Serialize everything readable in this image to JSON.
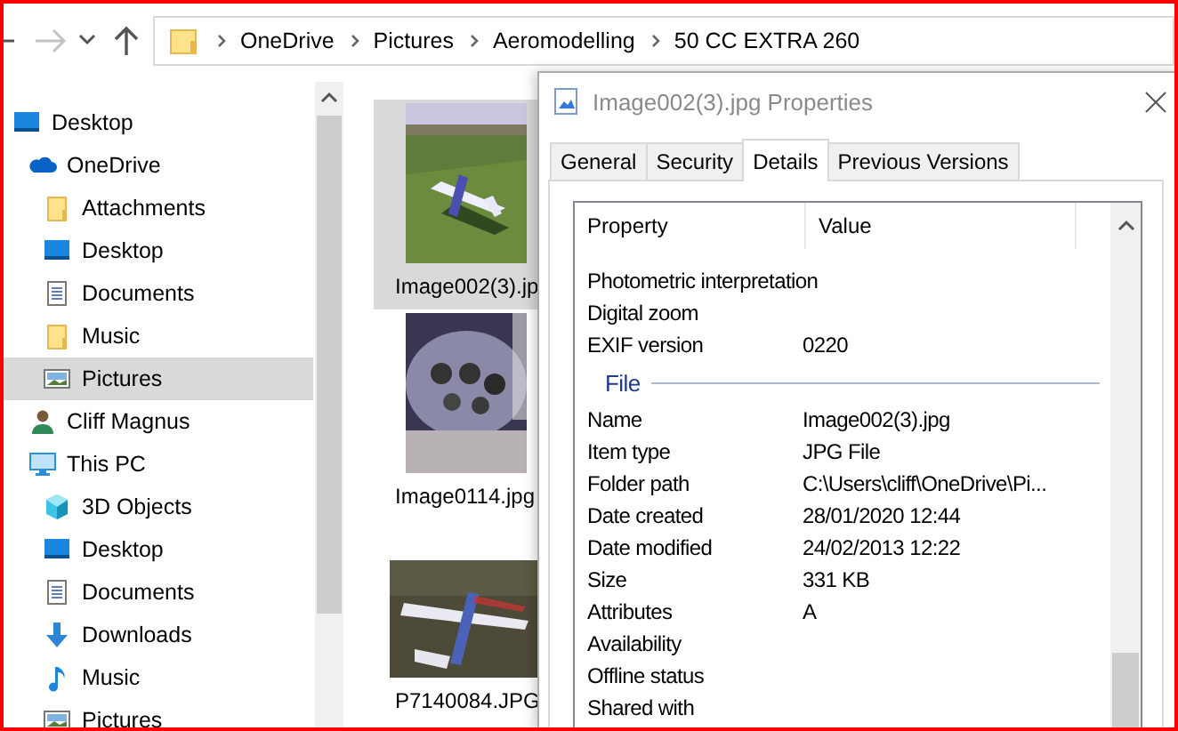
{
  "navigation": [
    {
      "kind": "back",
      "disabled": false
    },
    {
      "kind": "forward",
      "disabled": true
    },
    {
      "kind": "recent",
      "disabled": false
    },
    {
      "kind": "up",
      "disabled": false
    }
  ],
  "address_bar": {
    "path": [
      "OneDrive",
      "Pictures",
      "Aeromodelling",
      "50 CC EXTRA 260"
    ]
  },
  "tree": [
    {
      "label": "Desktop",
      "kind": "desktop",
      "selected": false,
      "children": [
        {
          "label": "OneDrive",
          "kind": "cloud",
          "selected": false,
          "children": [
            {
              "label": "Attachments",
              "kind": "folder",
              "selected": false
            },
            {
              "label": "Desktop",
              "kind": "desktop",
              "selected": false
            },
            {
              "label": "Documents",
              "kind": "document",
              "selected": false
            },
            {
              "label": "Music",
              "kind": "folder",
              "selected": false
            },
            {
              "label": "Pictures",
              "kind": "pictures",
              "selected": true
            }
          ]
        },
        {
          "label": "Cliff Magnus",
          "kind": "user",
          "selected": false
        },
        {
          "label": "This PC",
          "kind": "pc",
          "selected": false,
          "children": [
            {
              "label": "3D Objects",
              "kind": "cube",
              "selected": false
            },
            {
              "label": "Desktop",
              "kind": "desktop",
              "selected": false
            },
            {
              "label": "Documents",
              "kind": "document",
              "selected": false
            },
            {
              "label": "Downloads",
              "kind": "download",
              "selected": false
            },
            {
              "label": "Music",
              "kind": "music",
              "selected": false
            },
            {
              "label": "Pictures",
              "kind": "pictures",
              "selected": false
            }
          ]
        }
      ]
    }
  ],
  "thumbnails": [
    {
      "label": "Image002(3).jp",
      "selected": true
    },
    {
      "label": "Image0114.jpg",
      "selected": false
    },
    {
      "label": "P7140084.JPG",
      "selected": false
    }
  ],
  "dialog": {
    "title": "Image002(3).jpg Properties",
    "tabs": [
      {
        "label": "General",
        "selected": false
      },
      {
        "label": "Security",
        "selected": false
      },
      {
        "label": "Details",
        "selected": true
      },
      {
        "label": "Previous Versions",
        "selected": false
      }
    ],
    "columns": [
      "Property",
      "Value"
    ],
    "rows": [
      {
        "kind": "row",
        "property": "Photometric interpretation"
      },
      {
        "kind": "row",
        "property": "Digital zoom"
      },
      {
        "kind": "row",
        "property": "EXIF version",
        "value": "0220"
      },
      {
        "kind": "section",
        "property": "File"
      },
      {
        "kind": "row",
        "property": "Name",
        "value": "Image002(3).jpg"
      },
      {
        "kind": "row",
        "property": "Item type",
        "value": "JPG File"
      },
      {
        "kind": "row",
        "property": "Folder path",
        "value": "C:\\Users\\cliff\\OneDrive\\Pi..."
      },
      {
        "kind": "row",
        "property": "Date created",
        "value": "28/01/2020 12:44"
      },
      {
        "kind": "row",
        "property": "Date modified",
        "value": "24/02/2013 12:22"
      },
      {
        "kind": "row",
        "property": "Size",
        "value": "331 KB"
      },
      {
        "kind": "row",
        "property": "Attributes",
        "value": "A"
      },
      {
        "kind": "row",
        "property": "Availability"
      },
      {
        "kind": "row",
        "property": "Offline status"
      },
      {
        "kind": "row",
        "property": "Shared with"
      }
    ]
  }
}
